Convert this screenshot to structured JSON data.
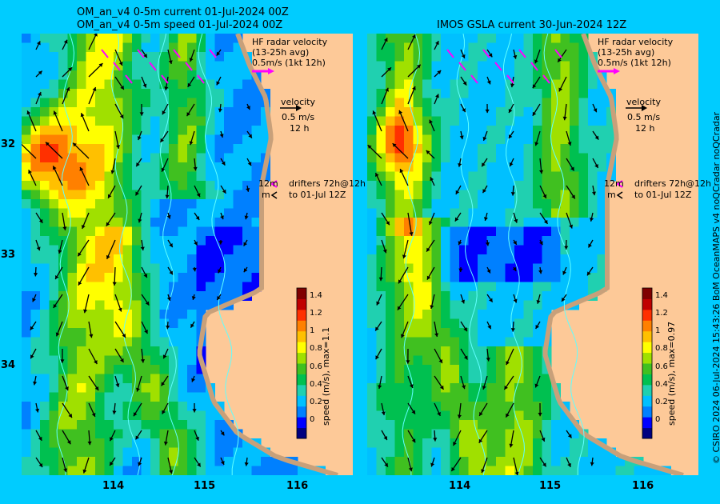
{
  "left_panel": {
    "title_line1": "OM_an_v4  0-5m current 01-Jul-2024 00Z",
    "title_line2": "OM_an_v4  0-5m speed 01-Jul-2024 00Z",
    "colorbar_label": "speed (m/s), max=1.1"
  },
  "right_panel": {
    "title_line1": "IMOS GSLA current 30-Jun-2024 12Z",
    "colorbar_label": "speed (m/s), max=0.97"
  },
  "legend": {
    "hf_radar_line1": "HF radar velocity",
    "hf_radar_line2": "(13-25h avg)",
    "hf_radar_line3": "0.5m/s (1kt 12h)",
    "velocity_line1": "velocity",
    "velocity_line2": "0.5 m/s",
    "velocity_line3": "12 h",
    "drifters_left": "12m",
    "drifters_line1": "drifters 72h@12h",
    "drifters_line2": "m",
    "drifters_line3": "to 01-Jul 12Z"
  },
  "axes": {
    "lat_ticks": [
      "32",
      "33",
      "34"
    ],
    "lon_ticks": [
      "114",
      "115",
      "116"
    ]
  },
  "colorbar": {
    "ticks": [
      "1.4",
      "1.2",
      "1",
      "0.8",
      "0.6",
      "0.4",
      "0.2",
      "0"
    ],
    "range": [
      -0.2,
      1.5
    ],
    "colors": [
      "#000080",
      "#0000ff",
      "#0080ff",
      "#00c0ff",
      "#20d0b0",
      "#00c050",
      "#40c020",
      "#a0e000",
      "#ffff00",
      "#ffc000",
      "#ff8000",
      "#ff3000",
      "#c00000",
      "#800000"
    ]
  },
  "colors": {
    "background": "#00ccff",
    "land": "#fdc998",
    "coast": "#c8a07a",
    "hf_radar_arrow": "#ff00ff",
    "coastline_water": "#60ffff"
  },
  "credit": "© CSIRO 2024   06-Jul-2024 15:43:26 BoM OceanMAPS v4 noQCradar noQCradar"
}
